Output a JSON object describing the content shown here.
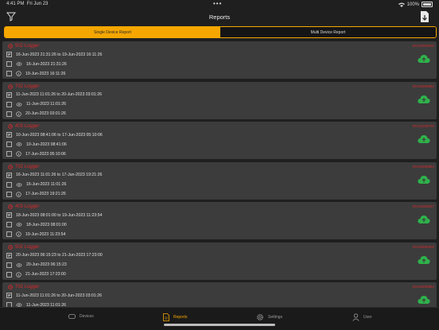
{
  "status_bar": {
    "time": "4:41 PM",
    "date": "Fri Jun 23",
    "battery": "100%"
  },
  "header": {
    "title": "Reports"
  },
  "segments": [
    {
      "label": "Single Device Report",
      "active": true
    },
    {
      "label": "Multi Device Report",
      "active": false
    }
  ],
  "colors": {
    "accent": "#f5a700",
    "logger_red": "#d6282b",
    "cloud_green": "#2fb24b",
    "card_bg": "#3c3c3c"
  },
  "reports": [
    {
      "name": "502 Logger",
      "sn": "SN:20490202",
      "range": "16-Jun-2023 21:31:26 to 19-Jun-2023 16:11:26",
      "start": "16-Jun-2023 21:31:26",
      "end": "19-Jun-2023 16:11:26"
    },
    {
      "name": "702 Logger",
      "sn": "SN:20490884",
      "range": "11-Jun-2023 11:01:26 to 20-Jun-2023 03:01:26",
      "start": "11-Jun-2023 11:01:26",
      "end": "20-Jun-2023 03:01:26"
    },
    {
      "name": "403 Logger",
      "sn": "SN:21030703",
      "range": "10-Jun-2023 08:41:06 to 17-Jun-2023 05:10:06",
      "start": "10-Jun-2023 08:41:06",
      "end": "17-Jun-2023 05:10:06"
    },
    {
      "name": "702 Logger",
      "sn": "SN:20490884",
      "range": "16-Jun-2023 11:01:26 to 17-Jun-2023 19:21:26",
      "start": "16-Jun-2023 11:01:26",
      "end": "17-Jun-2023 19:21:26"
    },
    {
      "name": "403 Logger",
      "sn": "SN:21030647",
      "range": "18-Jun-2023 08:01:00 to 19-Jun-2023 11:23:54",
      "start": "18-Jun-2023 08:01:00",
      "end": "19-Jun-2023 11:23:54"
    },
    {
      "name": "502 Logger",
      "sn": "SN:20490202",
      "range": "20-Jun-2023 06:15:23 to 21-Jun-2023 17:23:00",
      "start": "20-Jun-2023 06:15:23",
      "end": "21-Jun-2023 17:23:00"
    },
    {
      "name": "702 Logger",
      "sn": "SN:20490884",
      "range": "11-Jun-2023 11:01:26 to 20-Jun-2023 03:01:26",
      "start": "11-Jun-2023 11:01:26",
      "end": ""
    }
  ],
  "tabs": [
    {
      "label": "Devices",
      "icon": "device-icon",
      "active": false
    },
    {
      "label": "Reports",
      "icon": "report-icon",
      "active": true
    },
    {
      "label": "Settings",
      "icon": "gear-icon",
      "active": false
    },
    {
      "label": "User",
      "icon": "user-icon",
      "active": false
    }
  ]
}
